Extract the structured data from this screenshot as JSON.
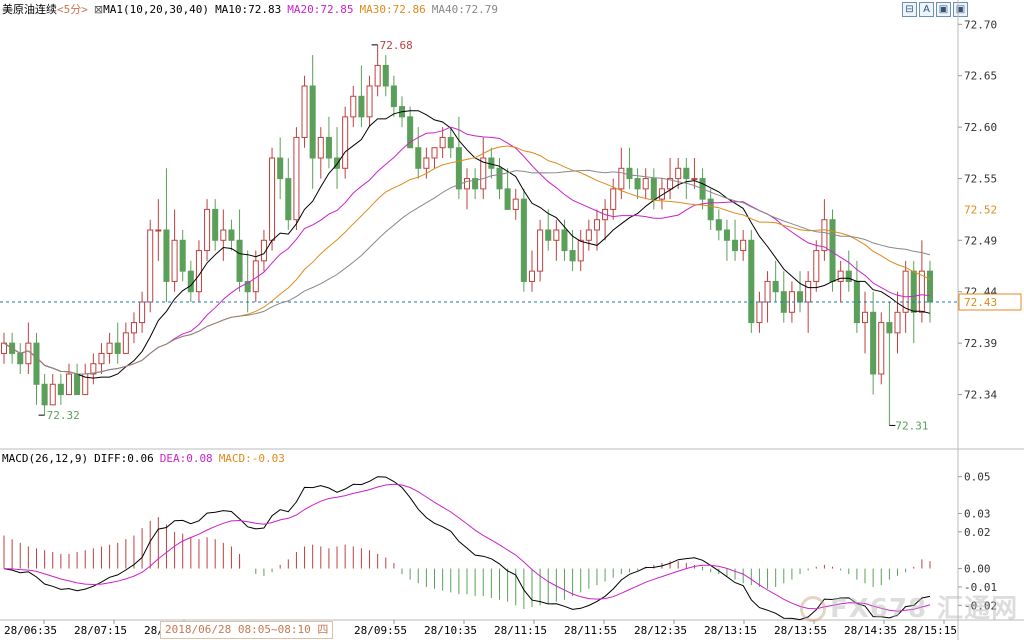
{
  "header": {
    "instrument": "美原油连续",
    "period": "<5分>",
    "ma_label": "MA1(10,20,30,40)",
    "ma10": "MA10:72.83",
    "ma20": "MA20:72.85",
    "ma30": "MA30:72.86",
    "ma40": "MA40:72.79"
  },
  "macd_header": {
    "label": "MACD(26,12,9)",
    "diff": "DIFF:0.06",
    "dea": "DEA:0.08",
    "macd": "MACD:-0.03"
  },
  "toolbar": {
    "b1": "⊟",
    "b2": "A",
    "b3": "▣",
    "b4": "▣"
  },
  "hover_date": "2018/06/28 08:05~08:10 四",
  "watermark": "FX678 汇通网",
  "colors": {
    "up": "#c04040",
    "down": "#5aa05a",
    "ma10": "#000000",
    "ma20": "#cc22cc",
    "ma30": "#e08a1a",
    "ma40": "#888888",
    "current": "#1a7ab0",
    "ma30_tag": "#e08a1a"
  },
  "chart_data": {
    "type": "candlestick",
    "price_axis": {
      "ticks": [
        "72.70",
        "72.65",
        "72.60",
        "72.55",
        "72.49",
        "72.44",
        "72.39",
        "72.34"
      ],
      "ylim": [
        72.29,
        72.71
      ]
    },
    "time_axis": [
      "28/06:35",
      "28/07:15",
      "28/0",
      "28/09:55",
      "28/10:35",
      "28/11:15",
      "28/11:55",
      "28/12:35",
      "28/13:15",
      "28/13:55",
      "28/14:35",
      "28/15:15"
    ],
    "current_price": "72.43",
    "ma30_tag": "72.52",
    "high_label": "72.68",
    "low_label": "72.31",
    "low_label_left": "72.32",
    "candles": [
      [
        72.38,
        72.4,
        72.37,
        72.39
      ],
      [
        72.39,
        72.4,
        72.37,
        72.38
      ],
      [
        72.38,
        72.39,
        72.36,
        72.37
      ],
      [
        72.37,
        72.41,
        72.36,
        72.39
      ],
      [
        72.39,
        72.4,
        72.33,
        72.35
      ],
      [
        72.35,
        72.36,
        72.32,
        72.33
      ],
      [
        72.33,
        72.36,
        72.33,
        72.35
      ],
      [
        72.35,
        72.36,
        72.33,
        72.34
      ],
      [
        72.34,
        72.37,
        72.34,
        72.36
      ],
      [
        72.36,
        72.37,
        72.34,
        72.34
      ],
      [
        72.34,
        72.37,
        72.34,
        72.36
      ],
      [
        72.36,
        72.38,
        72.35,
        72.37
      ],
      [
        72.37,
        72.39,
        72.36,
        72.38
      ],
      [
        72.38,
        72.4,
        72.37,
        72.39
      ],
      [
        72.39,
        72.41,
        72.37,
        72.38
      ],
      [
        72.38,
        72.41,
        72.38,
        72.4
      ],
      [
        72.4,
        72.42,
        72.39,
        72.41
      ],
      [
        72.41,
        72.44,
        72.4,
        72.43
      ],
      [
        72.43,
        72.51,
        72.42,
        72.5
      ],
      [
        72.5,
        72.53,
        72.47,
        72.5
      ],
      [
        72.5,
        72.56,
        72.43,
        72.45
      ],
      [
        72.45,
        72.52,
        72.44,
        72.49
      ],
      [
        72.49,
        72.5,
        72.45,
        72.46
      ],
      [
        72.46,
        72.47,
        72.43,
        72.44
      ],
      [
        72.44,
        72.49,
        72.43,
        72.48
      ],
      [
        72.48,
        72.53,
        72.47,
        72.52
      ],
      [
        72.52,
        72.53,
        72.48,
        72.49
      ],
      [
        72.49,
        72.52,
        72.47,
        72.5
      ],
      [
        72.5,
        72.51,
        72.48,
        72.49
      ],
      [
        72.49,
        72.52,
        72.44,
        72.45
      ],
      [
        72.45,
        72.48,
        72.42,
        72.44
      ],
      [
        72.44,
        72.48,
        72.43,
        72.47
      ],
      [
        72.47,
        72.5,
        72.46,
        72.49
      ],
      [
        72.49,
        72.58,
        72.48,
        72.57
      ],
      [
        72.57,
        72.59,
        72.53,
        72.55
      ],
      [
        72.55,
        72.57,
        72.5,
        72.51
      ],
      [
        72.51,
        72.6,
        72.5,
        72.59
      ],
      [
        72.59,
        72.65,
        72.58,
        72.64
      ],
      [
        72.64,
        72.67,
        72.54,
        72.57
      ],
      [
        72.57,
        72.6,
        72.55,
        72.59
      ],
      [
        72.59,
        72.61,
        72.56,
        72.57
      ],
      [
        72.57,
        72.6,
        72.54,
        72.56
      ],
      [
        72.56,
        72.62,
        72.55,
        72.61
      ],
      [
        72.61,
        72.64,
        72.6,
        72.63
      ],
      [
        72.63,
        72.66,
        72.6,
        72.61
      ],
      [
        72.61,
        72.65,
        72.6,
        72.64
      ],
      [
        72.64,
        72.68,
        72.63,
        72.66
      ],
      [
        72.66,
        72.67,
        72.63,
        72.64
      ],
      [
        72.64,
        72.65,
        72.61,
        72.62
      ],
      [
        72.62,
        72.63,
        72.6,
        72.61
      ],
      [
        72.61,
        72.62,
        72.58,
        72.58
      ],
      [
        72.58,
        72.6,
        72.55,
        72.56
      ],
      [
        72.56,
        72.58,
        72.55,
        72.57
      ],
      [
        72.57,
        72.58,
        72.56,
        72.58
      ],
      [
        72.58,
        72.6,
        72.57,
        72.59
      ],
      [
        72.59,
        72.6,
        72.57,
        72.58
      ],
      [
        72.58,
        72.61,
        72.53,
        72.54
      ],
      [
        72.54,
        72.56,
        72.52,
        72.55
      ],
      [
        72.55,
        72.56,
        72.53,
        72.54
      ],
      [
        72.54,
        72.59,
        72.53,
        72.57
      ],
      [
        72.57,
        72.58,
        72.55,
        72.56
      ],
      [
        72.56,
        72.57,
        72.53,
        72.54
      ],
      [
        72.54,
        72.56,
        72.52,
        72.52
      ],
      [
        72.52,
        72.54,
        72.51,
        72.53
      ],
      [
        72.53,
        72.54,
        72.44,
        72.45
      ],
      [
        72.45,
        72.48,
        72.44,
        72.46
      ],
      [
        72.46,
        72.51,
        72.45,
        72.5
      ],
      [
        72.5,
        72.52,
        72.48,
        72.49
      ],
      [
        72.49,
        72.51,
        72.47,
        72.5
      ],
      [
        72.5,
        72.51,
        72.47,
        72.48
      ],
      [
        72.48,
        72.5,
        72.46,
        72.47
      ],
      [
        72.47,
        72.5,
        72.46,
        72.49
      ],
      [
        72.49,
        72.51,
        72.48,
        72.5
      ],
      [
        72.5,
        72.52,
        72.48,
        72.51
      ],
      [
        72.51,
        72.53,
        72.49,
        72.52
      ],
      [
        72.52,
        72.55,
        72.51,
        72.54
      ],
      [
        72.54,
        72.58,
        72.53,
        72.56
      ],
      [
        72.56,
        72.58,
        72.54,
        72.55
      ],
      [
        72.55,
        72.56,
        72.53,
        72.54
      ],
      [
        72.54,
        72.56,
        72.53,
        72.55
      ],
      [
        72.55,
        72.56,
        72.52,
        72.53
      ],
      [
        72.53,
        72.55,
        72.52,
        72.54
      ],
      [
        72.54,
        72.57,
        72.53,
        72.55
      ],
      [
        72.55,
        72.57,
        72.54,
        72.56
      ],
      [
        72.56,
        72.57,
        72.53,
        72.55
      ],
      [
        72.55,
        72.57,
        72.54,
        72.55
      ],
      [
        72.55,
        72.56,
        72.52,
        72.53
      ],
      [
        72.53,
        72.54,
        72.5,
        72.51
      ],
      [
        72.51,
        72.52,
        72.49,
        72.5
      ],
      [
        72.5,
        72.51,
        72.47,
        72.49
      ],
      [
        72.49,
        72.51,
        72.47,
        72.48
      ],
      [
        72.48,
        72.5,
        72.47,
        72.49
      ],
      [
        72.49,
        72.5,
        72.4,
        72.41
      ],
      [
        72.41,
        72.44,
        72.4,
        72.43
      ],
      [
        72.43,
        72.46,
        72.41,
        72.45
      ],
      [
        72.45,
        72.47,
        72.43,
        72.44
      ],
      [
        72.44,
        72.46,
        72.41,
        72.42
      ],
      [
        72.42,
        72.45,
        72.41,
        72.44
      ],
      [
        72.44,
        72.46,
        72.42,
        72.43
      ],
      [
        72.43,
        72.46,
        72.4,
        72.45
      ],
      [
        72.45,
        72.49,
        72.44,
        72.48
      ],
      [
        72.48,
        72.53,
        72.47,
        72.51
      ],
      [
        72.51,
        72.52,
        72.44,
        72.45
      ],
      [
        72.45,
        72.47,
        72.43,
        72.46
      ],
      [
        72.46,
        72.48,
        72.44,
        72.45
      ],
      [
        72.45,
        72.47,
        72.4,
        72.41
      ],
      [
        72.41,
        72.44,
        72.38,
        72.42
      ],
      [
        72.42,
        72.44,
        72.34,
        72.36
      ],
      [
        72.36,
        72.42,
        72.35,
        72.41
      ],
      [
        72.41,
        72.43,
        72.31,
        72.4
      ],
      [
        72.4,
        72.44,
        72.38,
        72.42
      ],
      [
        72.42,
        72.47,
        72.4,
        72.46
      ],
      [
        72.46,
        72.47,
        72.39,
        72.42
      ],
      [
        72.42,
        72.49,
        72.41,
        72.46
      ],
      [
        72.46,
        72.47,
        72.41,
        72.43
      ]
    ],
    "macd_axis": {
      "ticks": [
        "0.05",
        "0.03",
        "0.02",
        "0.00",
        "-0.01",
        "-0.02"
      ],
      "ylim": [
        -0.028,
        0.058
      ]
    },
    "macd_hist": [
      0.018,
      0.016,
      0.014,
      0.012,
      0.011,
      0.01,
      0.009,
      0.008,
      0.008,
      0.009,
      0.01,
      0.011,
      0.012,
      0.013,
      0.014,
      0.016,
      0.018,
      0.022,
      0.026,
      0.028,
      0.024,
      0.02,
      0.019,
      0.017,
      0.016,
      0.017,
      0.016,
      0.014,
      0.012,
      0.008,
      0.004,
      0.0,
      -0.003,
      -0.004,
      -0.002,
      0.002,
      0.005,
      0.009,
      0.012,
      0.013,
      0.012,
      0.011,
      0.012,
      0.013,
      0.012,
      0.011,
      0.01,
      0.008,
      0.006,
      0.003,
      -0.003,
      -0.006,
      -0.008,
      -0.01,
      -0.011,
      -0.012,
      -0.013,
      -0.014,
      -0.014,
      -0.015,
      -0.015,
      -0.016,
      -0.017,
      -0.018,
      -0.02,
      -0.022,
      -0.021,
      -0.02,
      -0.019,
      -0.018,
      -0.017,
      -0.015,
      -0.013,
      -0.011,
      -0.009,
      -0.007,
      -0.005,
      -0.003,
      -0.002,
      -0.001,
      0.001,
      0.002,
      0.003,
      0.004,
      0.004,
      0.003,
      0.002,
      0.001,
      -0.001,
      -0.002,
      -0.003,
      -0.004,
      -0.006,
      -0.008,
      -0.009,
      -0.01,
      -0.011,
      -0.01,
      -0.008,
      -0.006,
      -0.003,
      -0.001,
      0.001,
      0.002,
      0.001,
      -0.001,
      -0.003,
      -0.006,
      -0.008,
      -0.01,
      -0.009,
      -0.006,
      -0.004,
      -0.002,
      0.001,
      0.005,
      0.004
    ]
  }
}
